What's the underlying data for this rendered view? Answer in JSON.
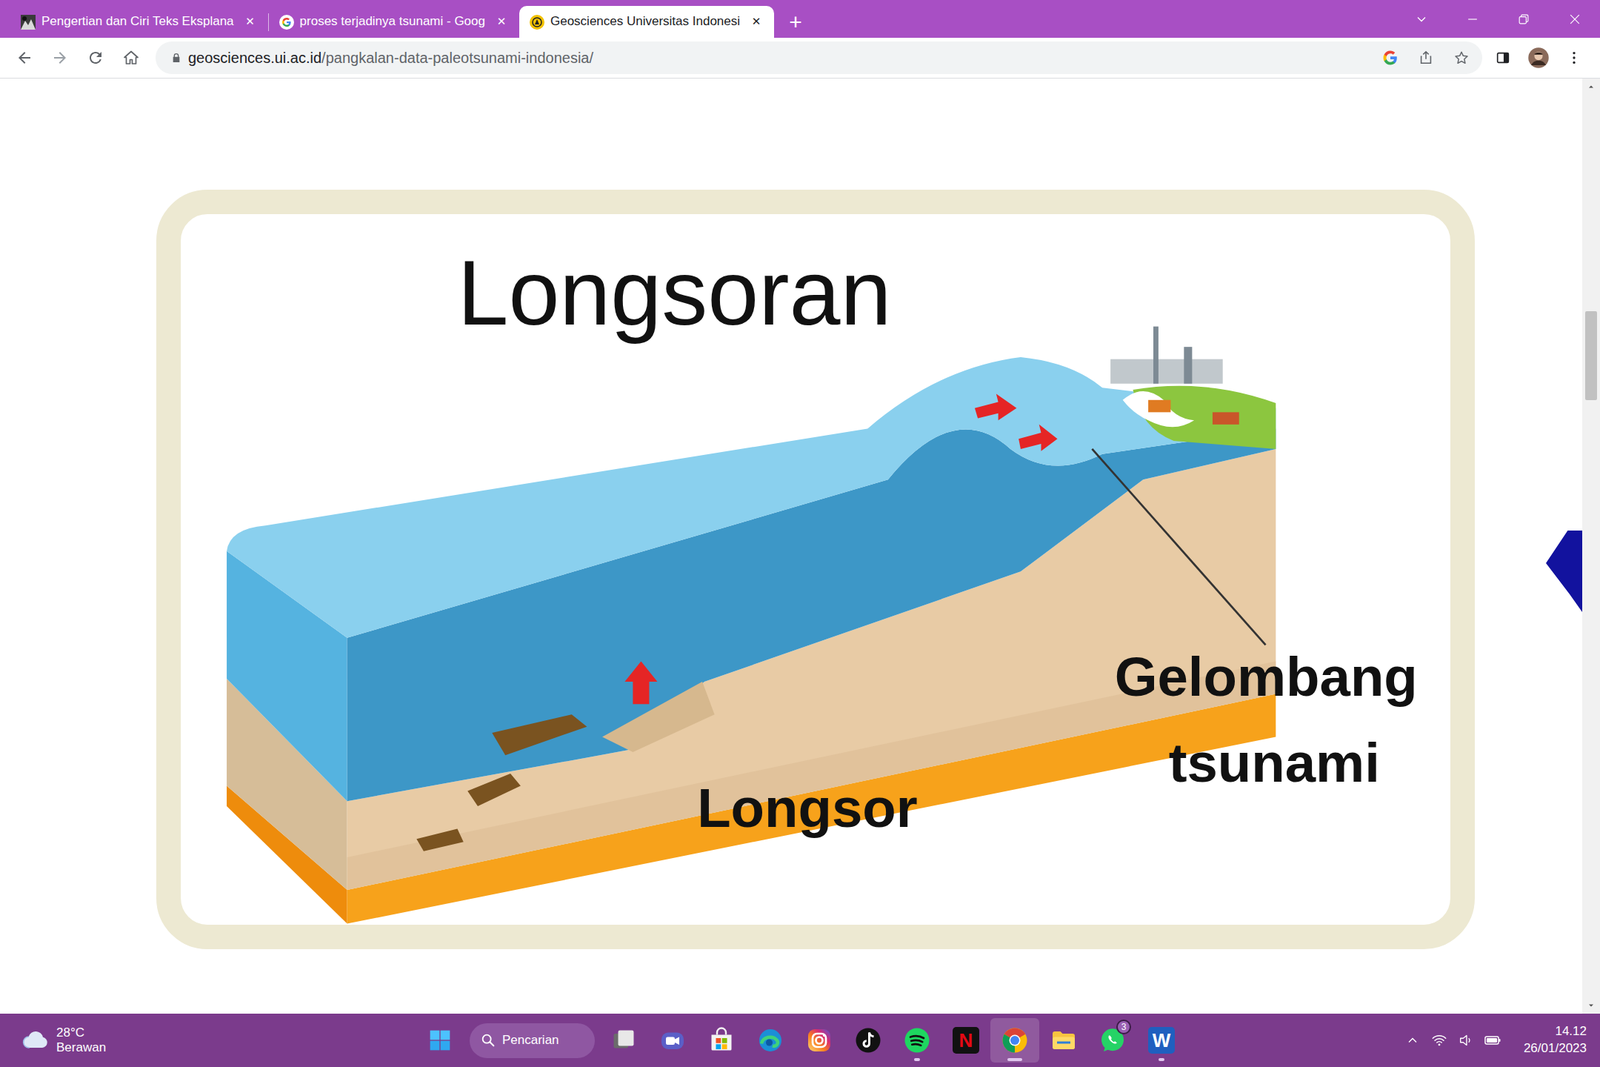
{
  "tabs": [
    {
      "label": "Pengertian dan Ciri Teks Eksplana",
      "selected": false,
      "close": "✕",
      "kind": "thumbnail"
    },
    {
      "label": "proses terjadinya tsunami - Goog",
      "selected": false,
      "close": "✕",
      "kind": "google"
    },
    {
      "label": "Geosciences Universitas Indonesi",
      "selected": true,
      "close": "✕",
      "kind": "ui"
    }
  ],
  "new_tab": "+",
  "address": {
    "domain": "geosciences.ui.ac.id",
    "path": "/pangkalan-data-paleotsunami-indonesia/"
  },
  "figure": {
    "title": "Longsoran",
    "wave_label": [
      "Gelombang",
      "tsunami"
    ],
    "slide_label": "Longsor"
  },
  "scrollbar": {
    "level": 0.24
  },
  "taskbar": {
    "weather": {
      "temperature": "28°C",
      "condition": "Berawan"
    },
    "search": "Pencarian",
    "apps": [
      {
        "kind": "task-view",
        "running": false,
        "selected": false
      },
      {
        "kind": "chat",
        "running": false,
        "selected": false
      },
      {
        "kind": "store",
        "running": false,
        "selected": false
      },
      {
        "kind": "edge",
        "running": false,
        "selected": false
      },
      {
        "kind": "instagram",
        "running": false,
        "selected": false
      },
      {
        "kind": "tiktok",
        "running": false,
        "selected": false
      },
      {
        "kind": "spotify",
        "running": true,
        "selected": false
      },
      {
        "kind": "netflix",
        "running": false,
        "selected": false,
        "glyph": "N"
      },
      {
        "kind": "chrome",
        "running": true,
        "selected": true
      },
      {
        "kind": "files",
        "running": false,
        "selected": false
      },
      {
        "kind": "whatsapp",
        "running": false,
        "selected": false,
        "badge": "3"
      },
      {
        "kind": "word",
        "running": true,
        "selected": false,
        "glyph": "W"
      }
    ],
    "clock": {
      "time": "14.12",
      "date": "26/01/2023"
    }
  }
}
